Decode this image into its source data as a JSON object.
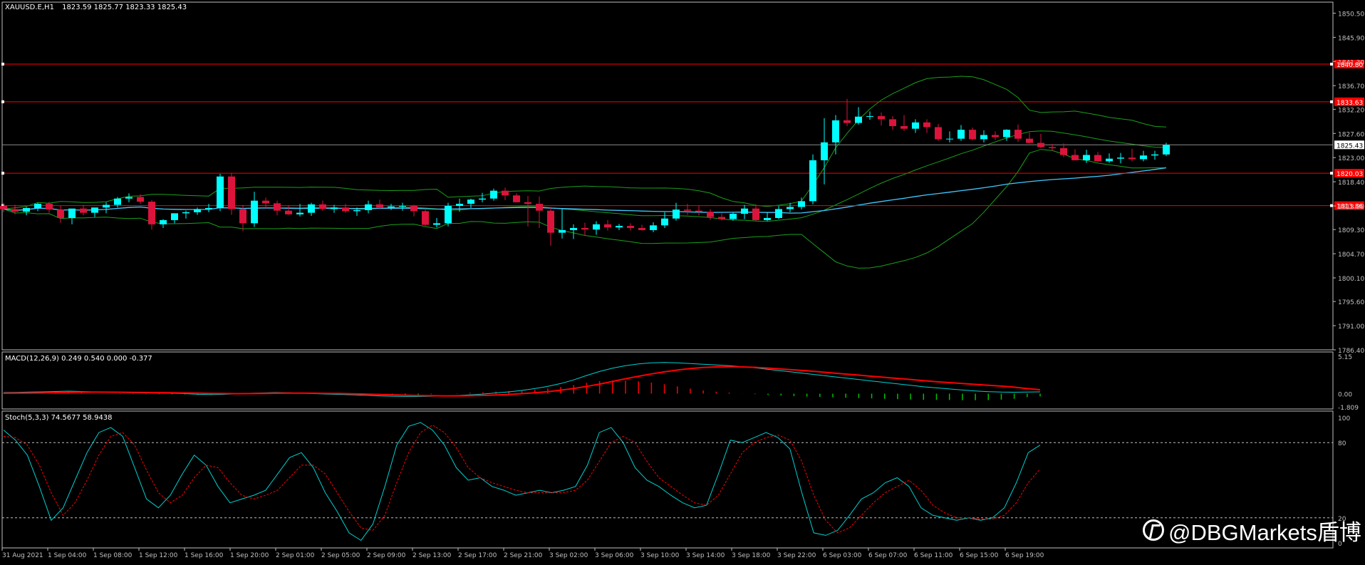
{
  "window": {
    "symbol_label": "XAUUSD.E,H1",
    "ohlc_label": "1823.59 1825.77 1823.33 1825.43"
  },
  "colors": {
    "background": "#000000",
    "bull_candle": "#00ffff",
    "bear_candle": "#dc143c",
    "bollinger": "#1a9f1a",
    "ma_line": "#40c8ff",
    "level_line": "#ff0000",
    "current_price_line": "#8c8c8c",
    "axis": "#c0c0c0",
    "macd_line": "#00d0d0",
    "macd_signal": "#ff0000",
    "macd_hist_pos": "#ff0000",
    "macd_hist_neg": "#00c000",
    "stoch_main": "#00d0d0",
    "stoch_signal": "#ff0000"
  },
  "price_axis": {
    "labels": [
      "1850.50",
      "1845.90",
      "1841.30",
      "1836.70",
      "1832.20",
      "1827.60",
      "1823.00",
      "1818.40",
      "1813.80",
      "1809.30",
      "1804.70",
      "1800.10",
      "1795.60",
      "1791.00",
      "1786.40"
    ]
  },
  "levels": [
    {
      "price": 1840.8,
      "label": "1840.80"
    },
    {
      "price": 1833.63,
      "label": "1833.63"
    },
    {
      "price": 1820.03,
      "label": "1820.03"
    },
    {
      "price": 1813.86,
      "label": "1813.86"
    }
  ],
  "current_price": {
    "price": 1825.43,
    "label": "1825.43"
  },
  "time_axis": {
    "labels": [
      "31 Aug 2021",
      "1 Sep 04:00",
      "1 Sep 08:00",
      "1 Sep 12:00",
      "1 Sep 16:00",
      "1 Sep 20:00",
      "2 Sep 01:00",
      "2 Sep 05:00",
      "2 Sep 09:00",
      "2 Sep 13:00",
      "2 Sep 17:00",
      "2 Sep 21:00",
      "3 Sep 02:00",
      "3 Sep 06:00",
      "3 Sep 10:00",
      "3 Sep 14:00",
      "3 Sep 18:00",
      "3 Sep 22:00",
      "6 Sep 03:00",
      "6 Sep 07:00",
      "6 Sep 11:00",
      "6 Sep 15:00",
      "6 Sep 19:00"
    ]
  },
  "macd": {
    "label": "MACD(12,26,9) 0.249 0.540 0.000 -0.377",
    "axis_labels": [
      "5.15",
      "0.00",
      "-1.809"
    ]
  },
  "stoch": {
    "label": "Stoch(5,3,3) 74.5677 58.9438",
    "axis_labels": [
      "100",
      "80",
      "20",
      "0"
    ]
  },
  "watermark": {
    "text": "@DBGMarkets盾博"
  },
  "chart_data": [
    {
      "type": "candlestick",
      "title": "XAUUSD.E,H1",
      "ylim": [
        1786.4,
        1852.6
      ],
      "open": [
        1813.8,
        1813.2,
        1812.7,
        1813.4,
        1814.2,
        1813.1,
        1811.5,
        1813.3,
        1812.5,
        1813.5,
        1814.0,
        1815.2,
        1815.5,
        1814.6,
        1810.3,
        1811.1,
        1812.4,
        1812.6,
        1813.2,
        1813.4,
        1819.4,
        1813.2,
        1810.5,
        1814.8,
        1814.3,
        1812.9,
        1812.2,
        1812.5,
        1814.1,
        1813.2,
        1813.5,
        1812.8,
        1813.0,
        1814.1,
        1813.5,
        1813.7,
        1813.8,
        1812.8,
        1810.2,
        1810.5,
        1813.8,
        1814.2,
        1815.0,
        1815.2,
        1816.7,
        1815.8,
        1814.5,
        1814.2,
        1812.9,
        1808.7,
        1809.2,
        1809.6,
        1809.3,
        1810.3,
        1809.7,
        1810.0,
        1809.6,
        1809.2,
        1810.1,
        1811.4,
        1813.1,
        1812.9,
        1812.7,
        1811.7,
        1811.3,
        1812.3,
        1813.3,
        1811.1,
        1811.5,
        1813.2,
        1813.6,
        1814.7,
        1822.5,
        1825.9,
        1830.1,
        1829.6,
        1830.8,
        1830.9,
        1830.3,
        1829.0,
        1828.5,
        1829.7,
        1828.8,
        1826.5,
        1826.6,
        1828.3,
        1826.5,
        1827.3,
        1826.9,
        1828.3,
        1826.6,
        1825.8,
        1825.0,
        1824.8,
        1823.5,
        1822.5,
        1823.5,
        1822.3,
        1822.8,
        1823.0,
        1822.7,
        1823.4,
        1823.6
      ],
      "high": [
        1814.4,
        1814.0,
        1813.6,
        1814.4,
        1814.6,
        1813.8,
        1812.0,
        1814.0,
        1813.4,
        1814.5,
        1815.5,
        1816.2,
        1816.0,
        1814.9,
        1811.3,
        1812.2,
        1812.9,
        1813.5,
        1814.2,
        1819.9,
        1820.1,
        1814.0,
        1816.5,
        1815.4,
        1814.8,
        1813.9,
        1814.2,
        1814.4,
        1814.8,
        1814.0,
        1814.2,
        1813.5,
        1814.8,
        1815.0,
        1814.2,
        1814.4,
        1814.0,
        1813.3,
        1811.5,
        1814.4,
        1815.2,
        1815.2,
        1816.3,
        1817.1,
        1817.3,
        1816.2,
        1815.7,
        1815.6,
        1813.6,
        1813.2,
        1810.3,
        1810.6,
        1810.9,
        1811.1,
        1810.4,
        1810.5,
        1810.2,
        1810.7,
        1812.6,
        1814.4,
        1814.2,
        1813.8,
        1813.2,
        1812.4,
        1812.6,
        1814.0,
        1814.1,
        1812.6,
        1813.8,
        1814.4,
        1815.4,
        1823.6,
        1830.5,
        1831.1,
        1834.2,
        1832.6,
        1831.8,
        1831.6,
        1830.9,
        1831.1,
        1830.3,
        1830.3,
        1829.4,
        1828.0,
        1829.2,
        1828.7,
        1828.2,
        1828.0,
        1828.4,
        1829.3,
        1827.8,
        1827.5,
        1825.6,
        1825.7,
        1824.6,
        1824.5,
        1824.1,
        1823.8,
        1823.9,
        1824.7,
        1824.3,
        1824.3,
        1825.8
      ],
      "low": [
        1812.6,
        1812.2,
        1812.0,
        1812.8,
        1812.5,
        1810.6,
        1810.3,
        1812.0,
        1811.7,
        1812.4,
        1813.5,
        1814.5,
        1814.2,
        1809.3,
        1809.6,
        1810.5,
        1811.4,
        1812.1,
        1812.6,
        1812.8,
        1812.1,
        1809.0,
        1809.8,
        1813.2,
        1812.0,
        1812.1,
        1811.8,
        1811.9,
        1812.9,
        1812.5,
        1812.5,
        1811.9,
        1812.4,
        1813.1,
        1813.0,
        1812.9,
        1811.8,
        1810.0,
        1809.7,
        1809.9,
        1812.7,
        1813.4,
        1814.5,
        1814.8,
        1814.9,
        1814.5,
        1809.9,
        1809.6,
        1806.2,
        1807.6,
        1807.5,
        1808.1,
        1808.3,
        1809.1,
        1809.2,
        1809.1,
        1809.1,
        1808.8,
        1809.6,
        1811.0,
        1812.1,
        1812.0,
        1811.1,
        1811.0,
        1811.0,
        1811.3,
        1810.9,
        1810.9,
        1811.3,
        1812.6,
        1813.1,
        1814.1,
        1817.9,
        1823.6,
        1829.0,
        1829.3,
        1830.2,
        1829.1,
        1828.3,
        1828.1,
        1827.7,
        1827.7,
        1826.2,
        1825.9,
        1826.2,
        1826.3,
        1825.9,
        1826.4,
        1826.2,
        1826.0,
        1825.7,
        1824.8,
        1824.3,
        1823.1,
        1822.8,
        1822.0,
        1822.2,
        1822.0,
        1821.9,
        1822.3,
        1822.3,
        1822.6,
        1823.3
      ],
      "close": [
        1813.2,
        1812.7,
        1813.4,
        1814.2,
        1813.1,
        1811.5,
        1813.3,
        1812.5,
        1813.5,
        1814.0,
        1815.2,
        1815.5,
        1814.6,
        1810.3,
        1811.1,
        1812.4,
        1812.6,
        1813.2,
        1813.4,
        1819.4,
        1813.2,
        1810.5,
        1814.8,
        1814.3,
        1812.9,
        1812.2,
        1812.5,
        1814.1,
        1813.2,
        1813.5,
        1812.8,
        1813.0,
        1814.1,
        1813.5,
        1813.7,
        1813.8,
        1812.8,
        1810.2,
        1810.5,
        1813.8,
        1814.2,
        1815.0,
        1815.2,
        1816.7,
        1815.8,
        1814.5,
        1814.2,
        1812.9,
        1808.7,
        1809.2,
        1809.6,
        1809.3,
        1810.3,
        1809.7,
        1810.0,
        1809.6,
        1809.2,
        1810.1,
        1811.4,
        1813.1,
        1812.9,
        1812.7,
        1811.7,
        1811.3,
        1812.3,
        1813.3,
        1811.1,
        1811.5,
        1813.2,
        1813.6,
        1814.7,
        1822.5,
        1825.9,
        1830.1,
        1829.6,
        1830.8,
        1830.9,
        1830.3,
        1829.0,
        1828.5,
        1829.7,
        1828.8,
        1826.5,
        1826.6,
        1828.3,
        1826.5,
        1827.3,
        1826.9,
        1828.3,
        1826.6,
        1825.8,
        1825.0,
        1824.8,
        1823.5,
        1822.5,
        1823.5,
        1822.3,
        1822.8,
        1823.0,
        1822.7,
        1823.4,
        1823.6,
        1825.4
      ]
    },
    {
      "type": "line",
      "title": "MACD(12,26,9)",
      "ylim": [
        -1.809,
        5.15
      ],
      "series": [
        {
          "values": [
            0.15,
            0.18,
            0.22,
            0.25,
            0.3,
            0.35,
            0.3,
            0.25,
            0.2,
            0.15,
            0.12,
            0.1,
            0.08,
            0.05,
            0.0,
            -0.08,
            -0.12,
            -0.08,
            -0.02,
            0.05,
            0.1,
            0.15,
            0.12,
            0.06,
            0.0,
            -0.05,
            -0.1,
            -0.15,
            -0.22,
            -0.3,
            -0.35,
            -0.38,
            -0.38,
            -0.35,
            -0.3,
            -0.25,
            -0.15,
            -0.05,
            0.1,
            0.25,
            0.45,
            0.7,
            1.0,
            1.4,
            1.9,
            2.5,
            3.05,
            3.5,
            3.85,
            4.1,
            4.25,
            4.3,
            4.25,
            4.15,
            4.05,
            3.95,
            3.85,
            3.7,
            3.55,
            3.35,
            3.15,
            2.95,
            2.75,
            2.55,
            2.35,
            2.15,
            1.95,
            1.75,
            1.55,
            1.35,
            1.15,
            0.95,
            0.8,
            0.65,
            0.5,
            0.38,
            0.28,
            0.22,
            0.2,
            0.22,
            0.249
          ]
        },
        {
          "values": [
            0.05,
            0.07,
            0.09,
            0.11,
            0.14,
            0.17,
            0.2,
            0.22,
            0.21,
            0.2,
            0.18,
            0.16,
            0.14,
            0.12,
            0.1,
            0.08,
            0.04,
            0.02,
            0.0,
            0.01,
            0.02,
            0.05,
            0.07,
            0.08,
            0.06,
            0.04,
            0.02,
            -0.02,
            -0.06,
            -0.1,
            -0.15,
            -0.2,
            -0.25,
            -0.28,
            -0.3,
            -0.3,
            -0.28,
            -0.24,
            -0.18,
            -0.1,
            0.0,
            0.12,
            0.28,
            0.48,
            0.72,
            1.0,
            1.32,
            1.68,
            2.05,
            2.4,
            2.72,
            3.0,
            3.25,
            3.45,
            3.6,
            3.68,
            3.7,
            3.68,
            3.62,
            3.52,
            3.4,
            3.28,
            3.15,
            3.0,
            2.85,
            2.7,
            2.55,
            2.4,
            2.25,
            2.1,
            1.95,
            1.8,
            1.65,
            1.52,
            1.4,
            1.28,
            1.16,
            1.04,
            0.9,
            0.7,
            0.54
          ]
        }
      ],
      "histogram": [
        0.1,
        0.11,
        0.13,
        0.14,
        0.16,
        0.18,
        0.1,
        0.03,
        -0.01,
        -0.05,
        -0.06,
        -0.06,
        -0.06,
        -0.07,
        -0.1,
        -0.16,
        -0.16,
        -0.1,
        -0.02,
        0.04,
        0.08,
        0.1,
        0.05,
        -0.02,
        -0.06,
        -0.09,
        -0.12,
        -0.13,
        -0.16,
        -0.2,
        -0.2,
        -0.18,
        -0.13,
        -0.07,
        0.0,
        0.05,
        0.13,
        0.19,
        0.28,
        0.35,
        0.45,
        0.58,
        0.72,
        0.92,
        1.18,
        1.5,
        1.73,
        1.82,
        1.8,
        1.7,
        1.53,
        1.3,
        1.0,
        0.7,
        0.45,
        0.27,
        0.15,
        0.02,
        -0.07,
        -0.17,
        -0.25,
        -0.33,
        -0.4,
        -0.45,
        -0.5,
        -0.55,
        -0.6,
        -0.65,
        -0.7,
        -0.75,
        -0.8,
        -0.85,
        -0.85,
        -0.87,
        -0.9,
        -0.9,
        -0.88,
        -0.82,
        -0.7,
        -0.48,
        -0.377
      ]
    },
    {
      "type": "line",
      "title": "Stoch(5,3,3)",
      "ylim": [
        0,
        100
      ],
      "series": [
        {
          "values": [
            90,
            82,
            70,
            45,
            18,
            28,
            50,
            72,
            88,
            92,
            85,
            60,
            35,
            28,
            38,
            55,
            70,
            62,
            45,
            32,
            35,
            38,
            42,
            55,
            68,
            72,
            60,
            40,
            25,
            8,
            2,
            15,
            45,
            78,
            93,
            96,
            90,
            78,
            60,
            50,
            52,
            45,
            42,
            38,
            40,
            42,
            40,
            42,
            45,
            62,
            88,
            92,
            80,
            60,
            50,
            45,
            38,
            32,
            28,
            30,
            55,
            82,
            80,
            84,
            88,
            84,
            75,
            40,
            8,
            6,
            10,
            22,
            35,
            40,
            48,
            52,
            45,
            28,
            22,
            20,
            18,
            20,
            18,
            20,
            28,
            48,
            72,
            78
          ]
        },
        {
          "values": [
            85,
            84,
            78,
            62,
            40,
            22,
            32,
            50,
            70,
            85,
            88,
            78,
            58,
            40,
            32,
            38,
            52,
            62,
            60,
            48,
            38,
            35,
            38,
            42,
            52,
            62,
            62,
            55,
            40,
            25,
            12,
            10,
            22,
            48,
            72,
            88,
            94,
            88,
            76,
            60,
            52,
            48,
            45,
            42,
            40,
            40,
            40,
            40,
            42,
            50,
            65,
            80,
            85,
            80,
            65,
            52,
            45,
            38,
            32,
            30,
            38,
            55,
            72,
            80,
            84,
            86,
            82,
            65,
            38,
            18,
            8,
            12,
            22,
            32,
            40,
            45,
            50,
            42,
            30,
            24,
            20,
            20,
            19,
            19,
            22,
            32,
            48,
            59
          ]
        }
      ]
    }
  ]
}
